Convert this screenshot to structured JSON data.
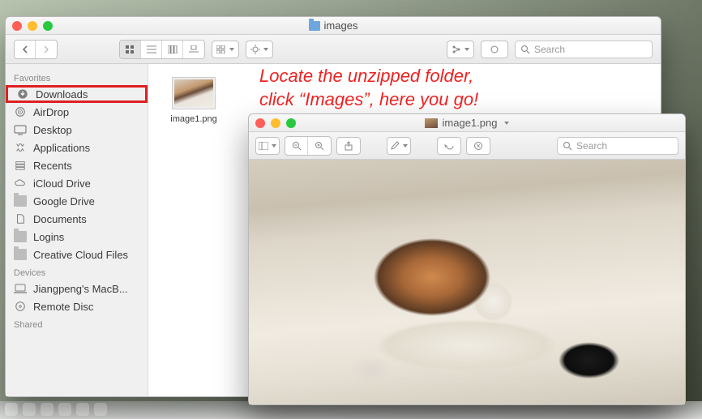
{
  "annotation": {
    "line1": "Locate the unzipped folder,",
    "line2": "click “Images”, here you go!"
  },
  "finder": {
    "title": "images",
    "search_placeholder": "Search",
    "sidebar": {
      "section_favorites": "Favorites",
      "section_devices": "Devices",
      "section_shared": "Shared",
      "items": [
        {
          "label": "Downloads"
        },
        {
          "label": "AirDrop"
        },
        {
          "label": "Desktop"
        },
        {
          "label": "Applications"
        },
        {
          "label": "Recents"
        },
        {
          "label": "iCloud Drive"
        },
        {
          "label": "Google Drive"
        },
        {
          "label": "Documents"
        },
        {
          "label": "Logins"
        },
        {
          "label": "Creative Cloud Files"
        }
      ],
      "devices": [
        {
          "label": "Jiangpeng's MacB..."
        },
        {
          "label": "Remote Disc"
        }
      ]
    },
    "file": {
      "name": "image1.png"
    }
  },
  "preview": {
    "title": "image1.png",
    "search_placeholder": "Search"
  }
}
